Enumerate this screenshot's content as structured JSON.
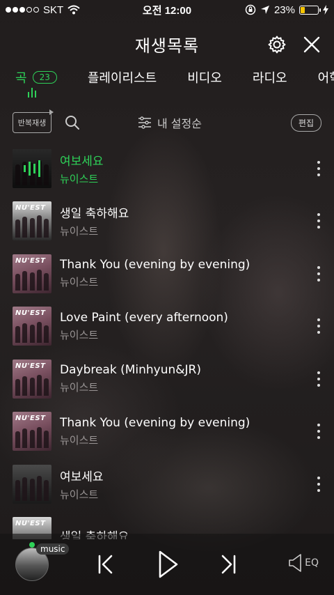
{
  "status_bar": {
    "carrier": "SKT",
    "time": "오전 12:00",
    "battery_percent": "23%",
    "battery_level": 0.23,
    "signal_dots_filled": 3,
    "signal_dots_total": 5
  },
  "header": {
    "title": "재생목록",
    "settings_icon": "gear-icon",
    "close_icon": "close-icon"
  },
  "tabs": [
    {
      "label": "곡",
      "badge": "23",
      "active": true
    },
    {
      "label": "플레이리스트",
      "active": false
    },
    {
      "label": "비디오",
      "active": false
    },
    {
      "label": "라디오",
      "active": false
    },
    {
      "label": "어학",
      "active": false
    }
  ],
  "toolbar": {
    "repeat_label": "반복재생",
    "sort_label": "내 설정순",
    "edit_label": "편집"
  },
  "tracks": [
    {
      "title": "여보세요",
      "artist": "뉴이스트",
      "playing": true
    },
    {
      "title": "생일 축하해요",
      "artist": "뉴이스트",
      "playing": false
    },
    {
      "title": "Thank You (evening by evening)",
      "artist": "뉴이스트",
      "playing": false
    },
    {
      "title": "Love Paint (every afternoon)",
      "artist": "뉴이스트",
      "playing": false
    },
    {
      "title": "Daybreak (Minhyun&JR)",
      "artist": "뉴이스트",
      "playing": false
    },
    {
      "title": "Thank You (evening by evening)",
      "artist": "뉴이스트",
      "playing": false
    },
    {
      "title": "여보세요",
      "artist": "뉴이스트",
      "playing": false
    },
    {
      "title": "생일 축하해요",
      "artist": "",
      "playing": false
    }
  ],
  "player": {
    "badge_label": "music",
    "eq_label": "EQ"
  },
  "colors": {
    "accent": "#2ed158",
    "battery": "#f5c400",
    "muted_text": "#9a9595"
  }
}
